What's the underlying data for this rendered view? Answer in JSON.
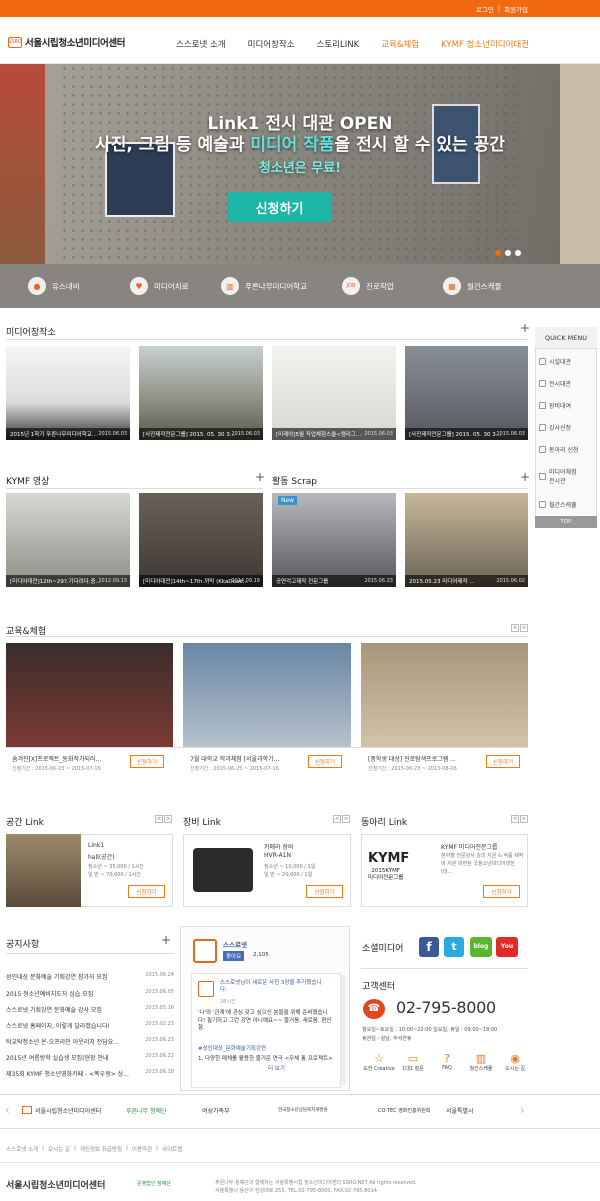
{
  "topbar": {
    "login": "로그인",
    "sep": "|",
    "join": "회원가입"
  },
  "header": {
    "logo_mark": "SSRO",
    "logo_text": "서울시립청소년미디어센터",
    "nav": [
      {
        "label": "스스로넷 소개"
      },
      {
        "label": "미디어창작소"
      },
      {
        "label": "스토리LINK"
      },
      {
        "label": "교육&체험"
      },
      {
        "label": "KYMF 청소년미디어대전"
      }
    ]
  },
  "hero": {
    "line1": "Link1 전시 대관 OPEN",
    "line2_a": "사진, 그림 등 예술과 ",
    "line2_b": "미디어 작품",
    "line2_c": "을 전시 할 수 있는 공간",
    "line3": "청소년은 무료!",
    "button": "신청하기"
  },
  "quick_bar": [
    {
      "label": "유스내비",
      "icon": "owl-icon"
    },
    {
      "label": "미디어치료",
      "icon": "heart-monitor-icon"
    },
    {
      "label": "푸른나무미디어학교",
      "icon": "school-icon"
    },
    {
      "label": "진로직업",
      "icon": "job-icon"
    },
    {
      "label": "월간스케쥴",
      "icon": "calendar-icon"
    }
  ],
  "media_lab": {
    "title": "미디어창작소",
    "items": [
      {
        "caption": "2015년 1학기 푸른나무미디어학교...",
        "date": "2015.06.03"
      },
      {
        "caption": "[사진제작전문그룹] 2015. 05. 30 3...",
        "date": "2015.06.03"
      },
      {
        "caption": "[미래야]5월 직업체험스쿨<캠리그...",
        "date": "2015.06.03"
      },
      {
        "caption": "[사진제작전문그룹] 2015. 05. 30 3...",
        "date": "2015.06.03"
      }
    ]
  },
  "kymf": {
    "title": "KYMF 영상",
    "items": [
      {
        "caption": "[미디어대전]12th~29?.기다려다.중...",
        "date": "2012.09.13"
      },
      {
        "caption": "[미디어대전]14th~17th.까막 (KkaDdak...",
        "date": "2014.09.19"
      }
    ]
  },
  "scrap": {
    "title": "활동 Scrap",
    "badge": "New",
    "items": [
      {
        "caption": "공연각고제작 전문그룹",
        "date": "2015.06.23"
      },
      {
        "caption": "2015.05.23 미디어제작 ...",
        "date": "2015.06.02"
      }
    ]
  },
  "quick_menu": {
    "title": "QUICK MENU",
    "items": [
      "시설대관",
      "전시대관",
      "장비대여",
      "강사신청",
      "동아리 신청",
      "미디어체험\n전시관",
      "월간스케쥴"
    ],
    "top": "TOP"
  },
  "education": {
    "title": "교육&체험",
    "arrows": [
      "<",
      ">"
    ],
    "items": [
      {
        "title": "숨겨진[X]프로젝트_동화작가되러...",
        "date": "신청기간 : 2015-06-23 ~ 2015-07-16",
        "button": "신청하기"
      },
      {
        "title": "7월 대학교 학과체험 [서울과학기...",
        "date": "신청기간 : 2015-06-25 ~ 2015-07-16",
        "button": "신청하기"
      },
      {
        "title": "[중학생 대상] 진로탐색프로그램 ...",
        "date": "신청기간 : 2015-06-23 ~ 2015-08-06",
        "button": "신청하기"
      }
    ]
  },
  "space_link": {
    "title": "공간 Link",
    "name": "Link1",
    "sub": "hall(공간)",
    "price1": "청소년 ~ 35,000 / 1시간",
    "price2": "일   반 ~ 70,000 / 1시간",
    "button": "신청하기"
  },
  "equip_link": {
    "title": "장비 Link",
    "name": "카메라 장비",
    "sub": "HVR-A1N",
    "price1": "청소년 ~ 10,000 / 1일",
    "price2": "일   반 ~ 20,000 / 1일",
    "button": "신청하기"
  },
  "club_link": {
    "title": "동아리 Link",
    "logo": "KYMF",
    "logo_sub": "2015KYMF\n미디어전문그룹",
    "name": "KYMF 미디어전문그룹",
    "desc": "분야별 전문강사 강의 지원 & 작품 제작비 지원 마련된 국청소년미디어대전(대...",
    "button": "신청하기"
  },
  "notice": {
    "title": "공지사항",
    "rows": [
      {
        "text": "성인대상 문화예술 기획강연 참가자 모집",
        "date": "2015.06.24"
      },
      {
        "text": "2015 청소년예비지도자 심습 모집",
        "date": "2015.06.05"
      },
      {
        "text": "스스로넷 기획강연 문화예술 강사 모집",
        "date": "2015.05.16"
      },
      {
        "text": "스스로넷 홈페이지, 이렇게 달라졌습니다!",
        "date": "2015.02.23"
      },
      {
        "text": "탁교탁청소년 온-오프라인 아웃리치 전담요...",
        "date": "2015.06.23"
      },
      {
        "text": "2015년 여름방학 실습생 모집(현장 안내",
        "date": "2015.06.22"
      },
      {
        "text": "제35회 KYMF 청소년영화카페 - <폭우왕> 상...",
        "date": "2015.06.18"
      }
    ]
  },
  "facebook": {
    "page": "스스로넷",
    "like": "좋아요",
    "count": "2,105",
    "post_title": "스스로넷님이 새로운 사진 3장을 추가했습니다.",
    "post_time": "38시간",
    "post_body": "'나'와 '관계'에 관심 갖고 싶으신 분들을 위해 준비했습니다! 필기하고 그런 강연 아니예요~~ 즐거움, 새로움, 편안함.",
    "post_tag": "#성인대상_문화예술기획강연",
    "post_list": "1. 다양한 매체를 활용한 즐거운 연극 <우체 통 프로젝트>",
    "more": "더 보기"
  },
  "social": {
    "title": "소셜미디어",
    "icons": [
      "f",
      "t",
      "blog",
      "You"
    ]
  },
  "customer": {
    "title": "고객센터",
    "phone": "02-795-8000",
    "hours1": "월요일~토요일 : 10:00~22:00  일요일, 휴일 : 09:00~18:00",
    "hours2": "휴관일 : 설날, 추석연휴",
    "links": [
      "도전 Creative",
      "1대1 질문",
      "FAQ",
      "월간스케쥴",
      "오시는 길"
    ]
  },
  "partners": [
    "서울시립청소년미디어센터",
    "푸른나무 청예단",
    "여성가족부",
    "한국청소년상담복지개발원",
    "CO-TEC 영화진흥위원회",
    "서울특별시"
  ],
  "footer": {
    "links": [
      "스스로넷 소개",
      "오시는 길",
      "개인정보 취급방침",
      "이용약관",
      "사이트맵"
    ],
    "logo": "서울시립청소년미디어센터",
    "sub_logo": "운영법인 청예단",
    "line1": "푸른나무 청예단과 함께하는 서울특별시립 청소년미디어센터 SSRO.NET All rights reserved.",
    "line2": "서울특별시 용산구 한강대로 255, TEL:02-795-8000, FAX:02-795-8014"
  }
}
